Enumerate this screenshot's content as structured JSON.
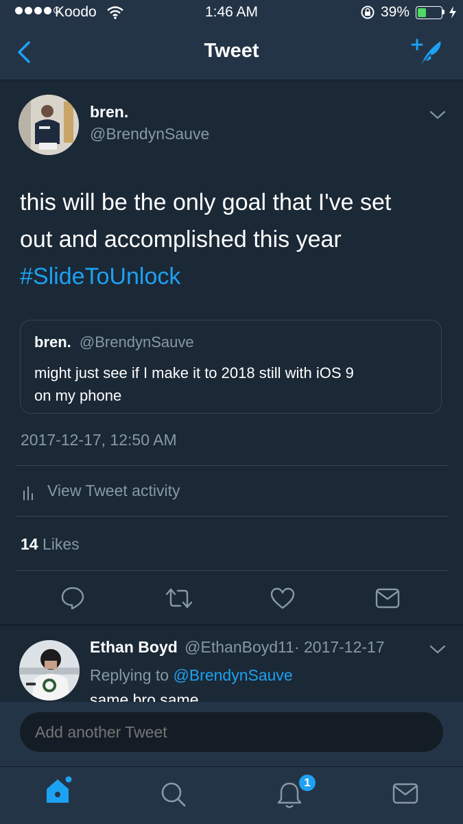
{
  "status": {
    "carrier": "Koodo",
    "time": "1:46 AM",
    "battery": "39%",
    "battery_level": 0.39,
    "signal_bars": 4
  },
  "nav": {
    "title": "Tweet",
    "back_icon": "chevron-left-icon",
    "compose_icon": "compose-feather-icon"
  },
  "tweet": {
    "name": "bren.",
    "handle": "@BrendynSauve",
    "text_line1": "this will be the only goal that I've set",
    "text_line2": "out and accomplished this year",
    "hashtag": "#SlideToUnlock",
    "quoted": {
      "name": "bren.",
      "handle": "@BrendynSauve",
      "text_line1": "might just see if I make it to 2018 still with iOS 9",
      "text_line2": "on my phone"
    },
    "timestamp": "2017-12-17, 12:50 AM",
    "activity_label": "View Tweet activity",
    "likes_count": "14",
    "likes_label": "Likes"
  },
  "reply": {
    "name": "Ethan Boyd",
    "handle": "@EthanBoyd11",
    "date": "· 2017-12-17",
    "replying_to_label": "Replying to",
    "replying_to_handle": "@BrendynSauve",
    "text": "same bro same"
  },
  "composer": {
    "placeholder": "Add another Tweet"
  },
  "tabbar": {
    "notifications_badge": "1"
  },
  "colors": {
    "background": "#1b2836",
    "bar": "#243447",
    "accent": "#1da1f2",
    "muted": "#8899a6",
    "divider": "#38444d"
  }
}
